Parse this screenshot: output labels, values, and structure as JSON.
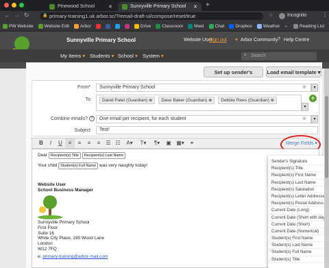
{
  "browser": {
    "tabs": [
      {
        "title": "Pinewood School"
      },
      {
        "title": "Sunnyville Primary School"
      }
    ],
    "new_tab": "+",
    "url": "primary-training1.uk.arbor.sc/?/email-draft-ui/compose/reset/true",
    "incognito": "Incognito",
    "bookmarks": [
      "PW Website",
      "Website Edit",
      "Arbor",
      "",
      "",
      "",
      "",
      "Drive",
      "Classroom",
      "Meet",
      "Chat",
      "Dropbox",
      "Weather"
    ],
    "reading_list": "Reading List"
  },
  "app": {
    "school_name": "Sunnyville Primary School",
    "user": "Website User",
    "sign_out": "Sign out",
    "community": "Arbor Community",
    "help": "Help Centre",
    "search_placeholder": "Search",
    "nav": [
      "My Items",
      "Students",
      "School",
      "System"
    ]
  },
  "actions": {
    "signature": "Set up sender's signature",
    "load_template": "Load email template"
  },
  "form": {
    "from_label": "From*",
    "from_value": "Sunnyville Primary School",
    "to_label": "To",
    "recipients": [
      "David Patel (Guardian)",
      "Dave Baker (Guardian)",
      "Debbie Rees (Guardian)"
    ],
    "combine_label": "Combine emails?",
    "combine_value": "One email per recipient, for each student",
    "subject_label": "Subject",
    "subject_value": "Test!"
  },
  "editor": {
    "merge_button": "Merge Fields",
    "line1_prefix": "Dear",
    "line1_tags": [
      "Recipient(s) Title",
      "Recipient(s) Last Name"
    ],
    "line2_prefix": "Your child",
    "line2_tag": "Student(s) Full Name",
    "line2_suffix": "was very naughty today!",
    "sig_name": "Website User",
    "sig_role": "School Business Manager",
    "address": [
      "Sunnyville Primary School",
      "First Floor",
      "Suite 16",
      "White City Place, 195 Wood Lane",
      "London",
      "W12 7FQ"
    ],
    "email_prefix": "e:",
    "email": "primary-training@arbor-mail.com"
  },
  "merge_fields": [
    "Sender's Signature",
    "Recipient(s) Title",
    "Recipient(s) First Name",
    "Recipient(s) Last Name",
    "Recipient(s) Salutation",
    "Recipient(s) Letter Addressee",
    "Recipient(s) Postal Address",
    "Current Date (Long)",
    "Current Date (Short with day)",
    "Current Date (Short)",
    "Current Date (Numerical)",
    "Student(s) First Name",
    "Student(s) Last Name",
    "Student(s) Full Name",
    "Student(s) Title"
  ],
  "colors": {
    "accent": "#f39c3a",
    "brand_green": "#5aa02c",
    "highlight_ring": "#e02020"
  }
}
